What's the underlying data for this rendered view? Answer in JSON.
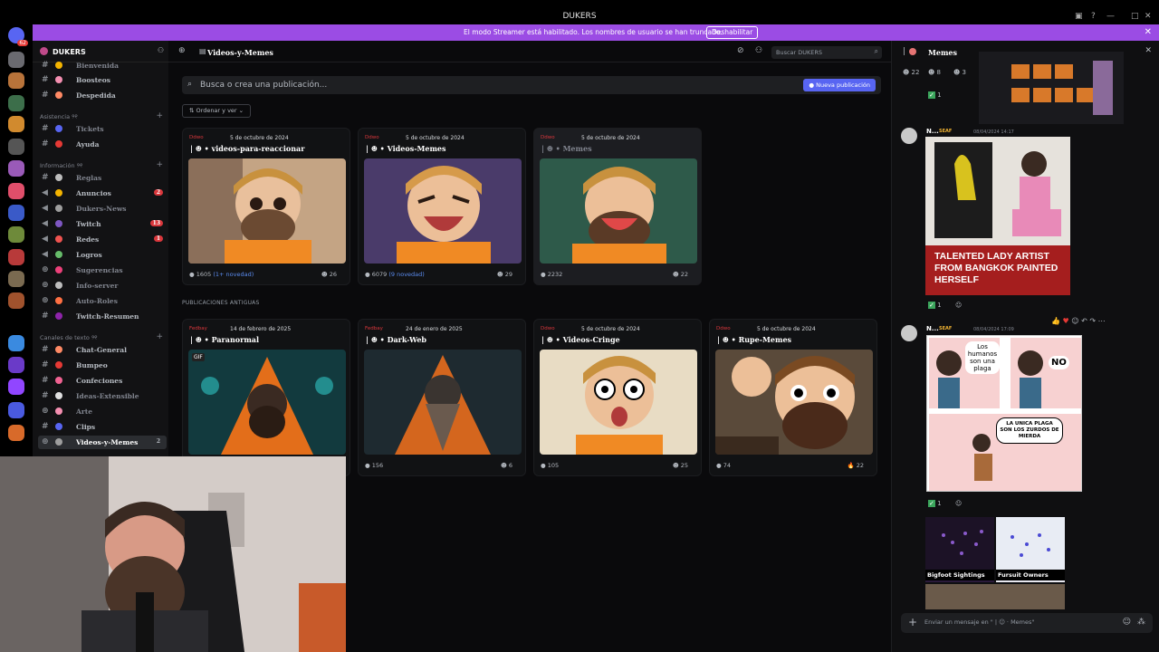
{
  "window": {
    "title": "DUKERS"
  },
  "banner": {
    "text": "El modo Streamer está habilitado. Los nombres de usuario se han truncado.",
    "button": "Deshabilitar",
    "bg": "#9b4ce4"
  },
  "rail": {
    "home_badge": "62"
  },
  "server": {
    "name": "DUKERS"
  },
  "sidebar": {
    "cat_asistencia": "Asistencia ୨୧",
    "cat_informacion": "Información ୨୧",
    "cat_texto": "Canales de texto ୨୧",
    "items": [
      {
        "label": "Bienvenida"
      },
      {
        "label": "Boosteos"
      },
      {
        "label": "Despedida"
      },
      {
        "label": "Tickets"
      },
      {
        "label": "Ayuda"
      },
      {
        "label": "Reglas"
      },
      {
        "label": "Anuncios",
        "badge": "2"
      },
      {
        "label": "Dukers-News"
      },
      {
        "label": "Twitch",
        "badge": "13"
      },
      {
        "label": "Redes",
        "badge": "1"
      },
      {
        "label": "Logros"
      },
      {
        "label": "Sugerencias"
      },
      {
        "label": "Info-server"
      },
      {
        "label": "Auto-Roles"
      },
      {
        "label": "Twitch-Resumen"
      },
      {
        "label": "Chat-General"
      },
      {
        "label": "Bumpeo"
      },
      {
        "label": "Confeciones"
      },
      {
        "label": "Ideas-Extensible"
      },
      {
        "label": "Arte"
      },
      {
        "label": "Clips"
      },
      {
        "label": "Videos-y-Memes",
        "badge": "2"
      }
    ]
  },
  "main": {
    "channel_title": "Videos-y-Memes",
    "search_placeholder": "Buscar DUKERS",
    "post_search_placeholder": "Busca o crea una publicación...",
    "new_post": "Nueva publicación",
    "sort": "Ordenar y ver",
    "old_posts_header": "PUBLICACIONES ANTIGUAS",
    "gif_label": "GIF",
    "recent": [
      {
        "tag": "Ddwo",
        "date": "5 de octubre de 2024",
        "title": "videos-para-reaccionar",
        "count": "1605",
        "novelty": "(1+ novedad)",
        "reactions": "26"
      },
      {
        "tag": "Ddwo",
        "date": "5 de octubre de 2024",
        "title": "Videos-Memes",
        "count": "6079",
        "novelty": "(9 novedad)",
        "reactions": "29"
      },
      {
        "tag": "Ddwo",
        "date": "5 de octubre de 2024",
        "title": "Memes",
        "count": "2232",
        "novelty": "",
        "reactions": "22"
      }
    ],
    "old": [
      {
        "tag": "Fedbay",
        "date": "14 de febrero de 2025",
        "title": "Paranormal",
        "count": "",
        "reactions": ""
      },
      {
        "tag": "Fedbay",
        "date": "24 de enero de 2025",
        "title": "Dark-Web",
        "count": "156",
        "reactions": "6"
      },
      {
        "tag": "Ddwo",
        "date": "5 de octubre de 2024",
        "title": "Videos-Cringe",
        "count": "105",
        "reactions": "25"
      },
      {
        "tag": "Ddwo",
        "date": "5 de octubre de 2024",
        "title": "Rupe-Memes",
        "count": "74",
        "reactions": "22"
      }
    ]
  },
  "right": {
    "title": "Memes",
    "reaction_counts": [
      "22",
      "8",
      "3"
    ],
    "msg1": {
      "author": "N...",
      "role": "SEAF",
      "time": "08/04/2024 14:17",
      "reaction": "1"
    },
    "meme1_caption": "TALENTED LADY ARTIST FROM BANGKOK PAINTED HERSELF",
    "msg2": {
      "author": "N...",
      "role": "SEAF",
      "time": "08/04/2024 17:09",
      "reaction": "1"
    },
    "comic": {
      "bubble1": "Los humanos son una plaga",
      "bubble2": "NO",
      "bubble3": "LA UNICA PLAGA SON LOS ZURDOS DE MIERDA"
    },
    "map1": "Bigfoot Sightings",
    "map2": "Fursuit Owners",
    "input_placeholder": "Enviar un mensaje en \" | ☺ · Memes\""
  }
}
